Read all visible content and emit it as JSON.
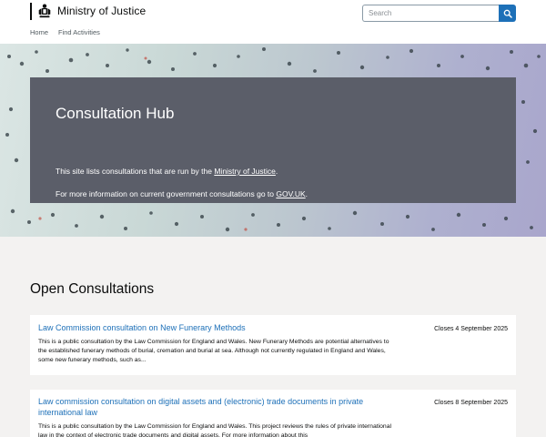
{
  "header": {
    "org_name": "Ministry of Justice",
    "search_placeholder": "Search"
  },
  "nav": {
    "items": [
      {
        "label": "Home"
      },
      {
        "label": "Find Activities"
      }
    ]
  },
  "hero": {
    "title": "Consultation Hub",
    "line1_prefix": "This site lists consultations that are run by the ",
    "line1_link": "Ministry of Justice",
    "line1_suffix": ".",
    "line2_prefix": "For more information on current government consultations go to ",
    "line2_link": "GOV.UK",
    "line2_suffix": "."
  },
  "section": {
    "title": "Open Consultations"
  },
  "consultations": [
    {
      "title": "Law Commission consultation on New Funerary Methods",
      "closes": "Closes 4 September 2025",
      "description": "This is a public consultation by the Law Commission for England and Wales. New Funerary Methods are potential alternatives to the established funerary methods of burial, cremation and burial at sea. Although not currently regulated in England and Wales, some new funerary methods, such as..."
    },
    {
      "title": "Law commission consultation on digital assets and (electronic) trade documents in private international law",
      "closes": "Closes 8 September 2025",
      "description": "This is a public consultation by the Law Commission for England and Wales. This project reviews the rules of private international law in the context of electronic trade documents and digital assets. For more information about this"
    }
  ],
  "colors": {
    "link": "#1d70b8",
    "panel": "#5b5e69",
    "page_background": "#f3f2f1"
  },
  "icons": {
    "crest": "royal-crest-icon",
    "search": "magnifier-icon"
  }
}
